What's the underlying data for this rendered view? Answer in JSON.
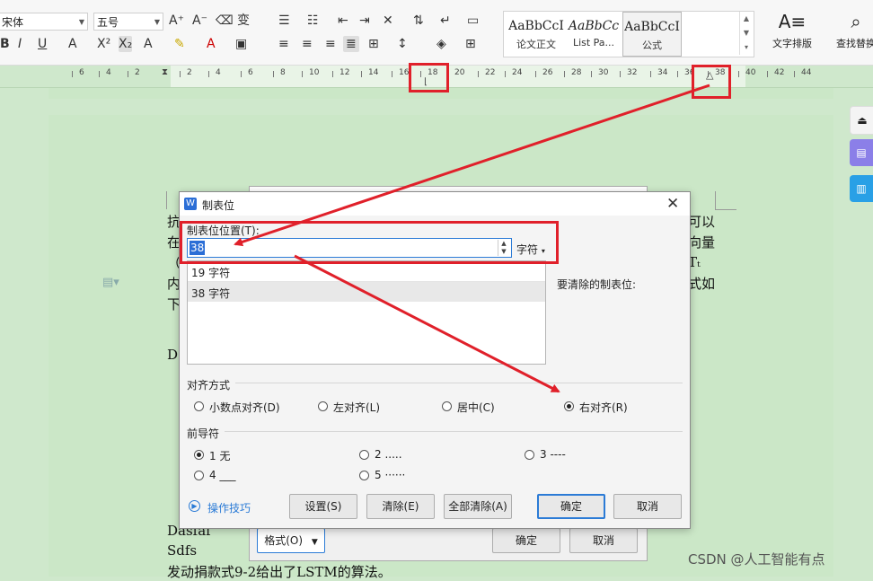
{
  "ribbon": {
    "font_name": "宋体",
    "font_size": "五号",
    "styles": [
      {
        "preview": "AaBbCcI",
        "label": "论文正文"
      },
      {
        "preview": "AaBbCc",
        "label": "List Pa..."
      },
      {
        "preview": "AaBbCcI",
        "label": "公式"
      }
    ],
    "text_layout_label": "文字排版",
    "find_label": "查找替换"
  },
  "ruler": {
    "labels": [
      "6",
      "4",
      "2",
      "2",
      "4",
      "6",
      "8",
      "10",
      "12",
      "14",
      "16",
      "18",
      "20",
      "22",
      "24",
      "26",
      "28",
      "30",
      "32",
      "34",
      "36",
      "38",
      "40",
      "42",
      "44"
    ]
  },
  "document": {
    "left_lines": [
      "抗",
      "在",
      "（",
      "内",
      "下"
    ],
    "right_lines": [
      "可以",
      "向量",
      "Tₜ",
      "式如"
    ],
    "lines_bottom": [
      "Dasfaf",
      "Sdfs",
      "发动捐款式9-2给出了LSTM的算法。"
    ],
    "partial_d": "D",
    "partial_paren": ")"
  },
  "back_dialog": {
    "format_button": "格式(O)",
    "ok_button": "确定",
    "cancel_button": "取消"
  },
  "dialog": {
    "title": "制表位",
    "position_label": "制表位位置(T):",
    "position_value": "38",
    "unit_label": "字符",
    "tab_list": [
      "19 字符",
      "38 字符"
    ],
    "clear_label": "要清除的制表位:",
    "alignment_label": "对齐方式",
    "alignments": [
      {
        "label": "小数点对齐(D)",
        "checked": false
      },
      {
        "label": "左对齐(L)",
        "checked": false
      },
      {
        "label": "居中(C)",
        "checked": false
      },
      {
        "label": "右对齐(R)",
        "checked": true
      }
    ],
    "leader_label": "前导符",
    "leaders": [
      {
        "label": "1 无",
        "checked": true
      },
      {
        "label": "2 .....",
        "checked": false
      },
      {
        "label": "3 ----",
        "checked": false
      },
      {
        "label": "4 ___",
        "checked": false
      },
      {
        "label": "5 ······",
        "checked": false
      }
    ],
    "tips_label": "操作技巧",
    "set_button": "设置(S)",
    "clear_button": "清除(E)",
    "clear_all_button": "全部清除(A)",
    "ok_button": "确定",
    "cancel_button": "取消"
  },
  "watermark": "CSDN @人工智能有点",
  "colors": {
    "annotation_red": "#e0202a",
    "page_green": "#cfe8cc",
    "accent_blue": "#2b7bd6"
  }
}
